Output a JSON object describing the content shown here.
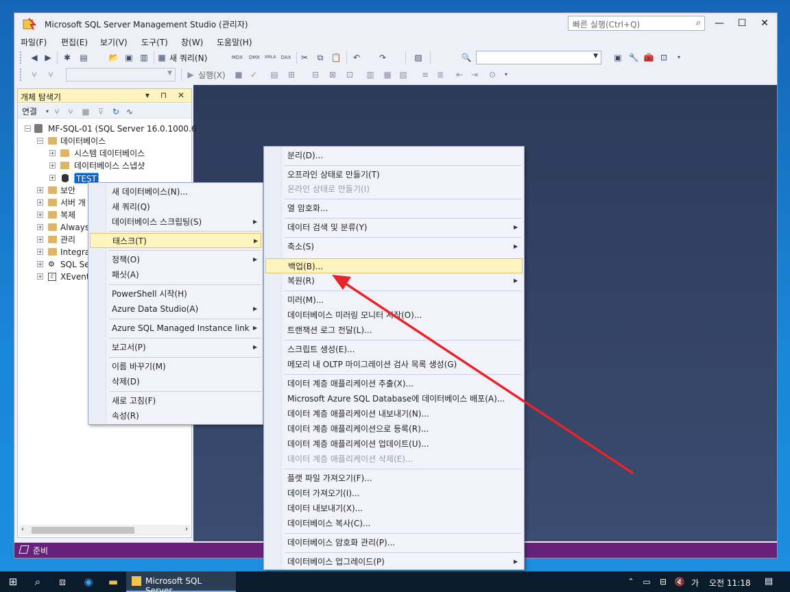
{
  "window": {
    "title": "Microsoft SQL Server Management Studio (관리자)",
    "quick_launch_placeholder": "빠른 실행(Ctrl+Q)"
  },
  "menubar": [
    "파일(F)",
    "편집(E)",
    "보기(V)",
    "도구(T)",
    "창(W)",
    "도움말(H)"
  ],
  "toolbar": {
    "new_query": "새 쿼리(N)",
    "execute": "실행(X)",
    "mdx": "MDX",
    "dmx": "DMX",
    "xmla": "XMLA",
    "dax": "DAX"
  },
  "object_explorer": {
    "title": "개체 탐색기",
    "connect": "연결",
    "tree": [
      {
        "label": "MF-SQL-01 (SQL Server 16.0.1000.6"
      },
      {
        "label": "데이터베이스"
      },
      {
        "label": "시스템 데이터베이스"
      },
      {
        "label": "데이터베이스 스냅샷"
      },
      {
        "label": "TEST"
      },
      {
        "label": "보안"
      },
      {
        "label": "서버 개"
      },
      {
        "label": "복제"
      },
      {
        "label": "Always"
      },
      {
        "label": "관리"
      },
      {
        "label": "Integra"
      },
      {
        "label": "SQL Se"
      },
      {
        "label": "XEvent"
      }
    ]
  },
  "context_menu_1": [
    "새 데이터베이스(N)...",
    "새 쿼리(Q)",
    "데이터베이스 스크립팅(S)",
    "태스크(T)",
    "정책(O)",
    "패싯(A)",
    "PowerShell 시작(H)",
    "Azure Data Studio(A)",
    "Azure SQL Managed Instance link",
    "보고서(P)",
    "이름 바꾸기(M)",
    "삭제(D)",
    "새로 고침(F)",
    "속성(R)"
  ],
  "context_menu_2": [
    "분리(D)...",
    "오프라인 상태로 만들기(T)",
    "온라인 상태로 만들기(I)",
    "열 암호화...",
    "데이터 검색 및 분류(Y)",
    "축소(S)",
    "백업(B)...",
    "복원(R)",
    "미러(M)...",
    "데이터베이스 미러링 모니터 시작(O)...",
    "트랜잭션 로그 전달(L)...",
    "스크립트 생성(E)...",
    "메모리 내 OLTP 마이그레이션 검사 목록 생성(G)",
    "데이터 계층 애플리케이션 추출(X)...",
    "Microsoft Azure SQL Database에 데이터베이스 배포(A)...",
    "데이터 계층 애플리케이션 내보내기(N)...",
    "데이터 계층 애플리케이션으로 등록(R)...",
    "데이터 계층 애플리케이션 업데이트(U)...",
    "데이터 계층 애플리케이션 삭제(E)...",
    "플랫 파일 가져오기(F)...",
    "데이터 가져오기(I)...",
    "데이터 내보내기(X)...",
    "데이터베이스 복사(C)...",
    "데이터베이스 암호화 관리(P)...",
    "데이터베이스 업그레이드(P)"
  ],
  "statusbar": {
    "text": "준비"
  },
  "taskbar": {
    "app_label": "Microsoft SQL Server...",
    "ime": "가",
    "clock": "오전 11:18"
  },
  "colors": {
    "accent": "#68217a",
    "highlight": "#fdf4bf",
    "annotation_arrow": "#e8242a"
  }
}
